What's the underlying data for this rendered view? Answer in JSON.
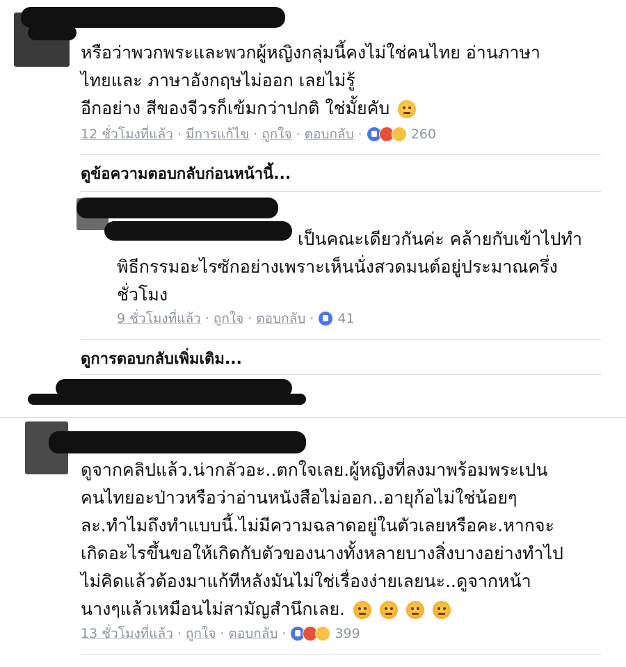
{
  "comments": [
    {
      "lines": [
        "หรือว่าพวกพระและพวกผู้หญิงกลุ่มนี้คงไม่ใช่คนไทย อ่านภาษา",
        "ไทยและ ภาษาอังกฤษไม่ออก เลยไม่รู้",
        "อีกอย่าง สีของจีวรก็เข้มกว่าปกติ ใช่มั้ยคับ"
      ],
      "emoji": "thinking-face",
      "time": "12 ชั่วโมงที่แล้ว",
      "edited": "มีการแก้ไข",
      "like": "ถูกใจ",
      "reply": "ตอบกลับ",
      "reactions": [
        "like",
        "angry",
        "sad"
      ],
      "count": "260"
    },
    {
      "lines": [
        "ดูจากคลิปแล้ว.น่ากลัวอะ..ตกใจเลย.ผู้หญิงที่ลงมาพร้อมพระเปน",
        "คนไทยอะป่าวหรือว่าอ่านหนังสือไม่ออก..อายุก้อไม่ใช่น้อยๆ",
        "ละ.ทำไมถึงทำแบบนี้.ไม่มีความฉลาดอยู่ในตัวเลยหรือคะ.หากจะ",
        "เกิดอะไรขึ้นขอให้เกิดกับตัวของนางทั้งหลายบางสิ่งบางอย่างทำไป",
        "ไม่คิดแล้วต้องมาแก้ทีหลังมันไม่ใช่เรื่องง่ายเลยนะ..ดูจากหน้า",
        "นางๆแล้วเหมือนไม่สามัญสำนึกเลย."
      ],
      "time": "13 ชั่วโมงที่แล้ว",
      "like": "ถูกใจ",
      "reply": "ตอบกลับ",
      "reactions": [
        "like",
        "angry",
        "haha"
      ],
      "count": "399"
    }
  ],
  "previous_replies": "ดูข้อความตอบกลับก่อนหน้านี้...",
  "reply": {
    "lines": [
      "เป็นคณะเดียวกันค่ะ คล้ายกับเข้าไปทำ",
      "พิธีกรรมอะไรซักอย่างเพราะเห็นนั่งสวดมนต์อยู่ประมาณครึ่ง",
      "ชั่วโมง"
    ],
    "time": "9 ชั่วโมงที่แล้ว",
    "like": "ถูกใจ",
    "reply": "ตอบกลับ",
    "count": "41"
  },
  "more_replies": "ดูการตอบกลับเพิ่มเติม...",
  "colors": {
    "like": "#4a76e8",
    "angry": "#e9503a",
    "sad": "#f6c243",
    "meta": "#8d949e"
  }
}
